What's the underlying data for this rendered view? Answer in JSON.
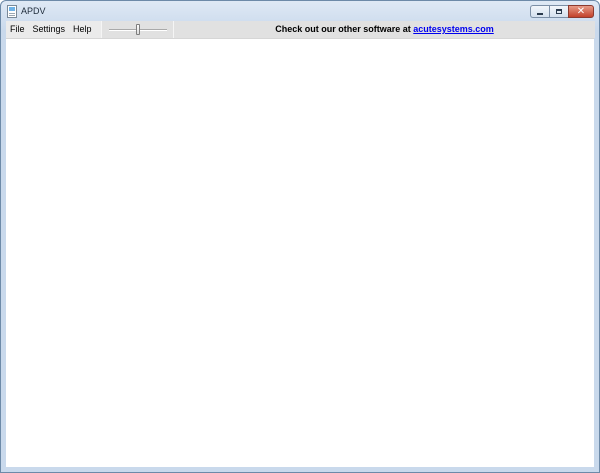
{
  "window": {
    "title": "APDV",
    "icon": "document-icon",
    "caption_buttons": {
      "minimize_icon": "minimize-icon",
      "maximize_icon": "maximize-icon",
      "close_glyph": "✕"
    }
  },
  "menu": {
    "items": [
      {
        "label": "File"
      },
      {
        "label": "Settings"
      },
      {
        "label": "Help"
      }
    ]
  },
  "zoom_slider": {
    "level": 0.5
  },
  "promo": {
    "text": "Check out our other software at ",
    "link_text": "acutesystems.com"
  },
  "colors": {
    "link": "#0000ee",
    "toolbar_bg": "#ebebeb",
    "window_frame": "#c9d9ec",
    "close_button": "#c2412a"
  }
}
